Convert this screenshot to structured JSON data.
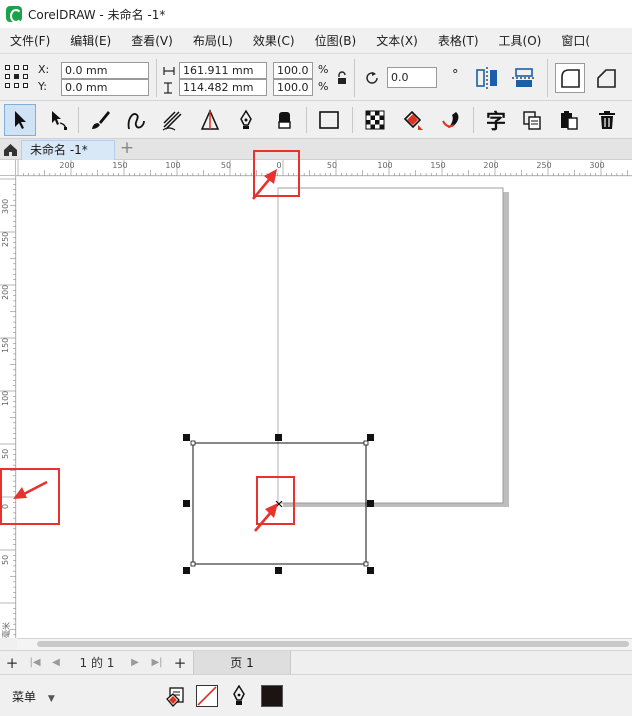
{
  "window": {
    "title": "CorelDRAW - 未命名 -1*"
  },
  "menu": [
    "文件(F)",
    "编辑(E)",
    "查看(V)",
    "布局(L)",
    "效果(C)",
    "位图(B)",
    "文本(X)",
    "表格(T)",
    "工具(O)",
    "窗口("
  ],
  "propbar": {
    "x_label": "X:",
    "x_value": "0.0 mm",
    "y_label": "Y:",
    "y_value": "0.0 mm",
    "width_value": "161.911 mm",
    "height_value": "114.482 mm",
    "scale_w": "100.0",
    "scale_h": "100.0",
    "pct": "%",
    "rotation_value": "0.0",
    "degree": "°"
  },
  "document_tab": {
    "label": "未命名 -1*",
    "add": "+"
  },
  "ruler": {
    "h_labels": [
      "200",
      "150",
      "100",
      "50",
      "0",
      "50",
      "100",
      "150",
      "200",
      "250",
      "300"
    ],
    "v_labels": [
      "300",
      "250",
      "200",
      "150",
      "100",
      "50",
      "0",
      "50"
    ],
    "unit": "毫米"
  },
  "pagenav": {
    "add": "+",
    "first": "|◀",
    "prev": "◀",
    "page_info": "1 的 1",
    "next": "▶",
    "last": "▶|",
    "add2": "+",
    "page_tab": "页 1"
  },
  "statusbar": {
    "menu_label": "菜单",
    "fill_color": "#1b1413"
  },
  "colors": {
    "accent": "#e8322e",
    "selection_bg": "#cfe3f5"
  }
}
